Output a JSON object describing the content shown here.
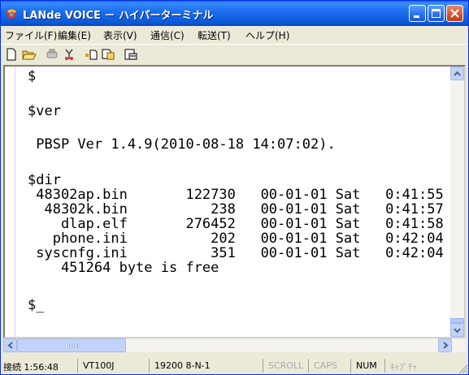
{
  "window": {
    "title": "LANde VOICE － ハイパーターミナル",
    "icon": "hyperterminal-phone-icon",
    "controls": [
      "minimize-icon",
      "maximize-icon",
      "close-icon"
    ]
  },
  "menu": {
    "items": [
      {
        "label": "ファイル(F)"
      },
      {
        "label": "編集(E)"
      },
      {
        "label": "表示(V)"
      },
      {
        "label": "通信(C)"
      },
      {
        "label": "転送(T)"
      },
      {
        "label": "ヘルプ(H)"
      }
    ]
  },
  "toolbar": {
    "buttons": [
      "new-icon",
      "open-icon",
      "connect-icon",
      "disconnect-icon",
      "send-icon",
      "receive-icon",
      "properties-icon"
    ]
  },
  "terminal": {
    "lines": [
      "$",
      "",
      "$ver",
      "",
      " PBSP Ver 1.4.9(2010-08-18 14:07:02).",
      "",
      "$dir",
      " 48302ap.bin       122730   00-01-01 Sat   0:41:55",
      "  48302k.bin          238   00-01-01 Sat   0:41:57",
      "    dlap.elf       276452   00-01-01 Sat   0:41:58",
      "   phone.ini          202   00-01-01 Sat   0:42:04",
      " syscnfg.ini          351   00-01-01 Sat   0:42:04",
      "    451264 byte is free",
      "",
      "$_"
    ]
  },
  "statusbar": {
    "connection": "接続 1:56:48",
    "emulation": "VT100J",
    "port_settings": "19200 8-N-1",
    "scroll": "SCROLL",
    "caps": "CAPS",
    "num": "NUM",
    "capture": "ｷｬﾌﾟﾁｬ"
  },
  "colors": {
    "titlebar": "#0a58d6",
    "terminal_bg": "#ffffff",
    "terminal_fg": "#000000",
    "chrome": "#ece9d8"
  }
}
